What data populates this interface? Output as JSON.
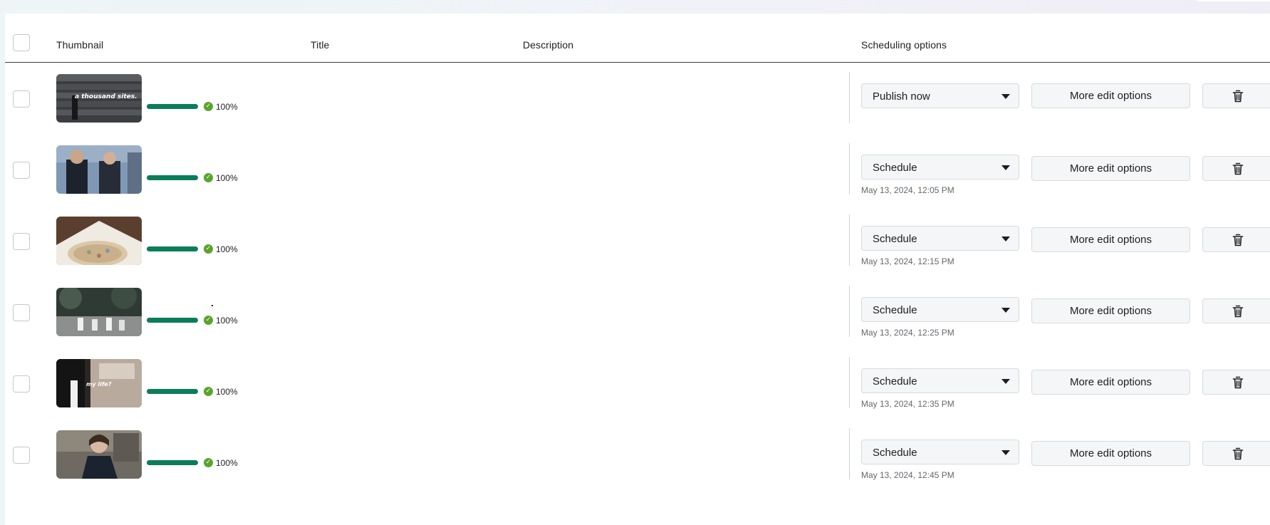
{
  "header": {
    "thumbnail": "Thumbnail",
    "title": "Title",
    "description": "Description",
    "scheduling": "Scheduling options"
  },
  "rows": [
    {
      "thumb_caption": "a thousand sites.",
      "progress_percent": 100,
      "progress_label": "100%",
      "schedule_option": "Publish now",
      "date": "",
      "edit_label": "More edit options"
    },
    {
      "thumb_caption": "",
      "progress_percent": 100,
      "progress_label": "100%",
      "schedule_option": "Schedule",
      "date": "May 13, 2024, 12:05 PM",
      "edit_label": "More edit options"
    },
    {
      "thumb_caption": "",
      "progress_percent": 100,
      "progress_label": "100%",
      "schedule_option": "Schedule",
      "date": "May 13, 2024, 12:15 PM",
      "edit_label": "More edit options"
    },
    {
      "thumb_caption": "",
      "progress_percent": 100,
      "progress_label": "100%",
      "schedule_option": "Schedule",
      "date": "May 13, 2024, 12:25 PM",
      "edit_label": "More edit options"
    },
    {
      "thumb_caption": "my life?",
      "progress_percent": 100,
      "progress_label": "100%",
      "schedule_option": "Schedule",
      "date": "May 13, 2024, 12:35 PM",
      "edit_label": "More edit options"
    },
    {
      "thumb_caption": "",
      "progress_percent": 100,
      "progress_label": "100%",
      "schedule_option": "Schedule",
      "date": "May 13, 2024, 12:45 PM",
      "edit_label": "More edit options"
    }
  ],
  "icons": {
    "status": "check-circle-icon",
    "dropdown": "chevron-down-icon",
    "delete": "trash-icon"
  },
  "colors": {
    "progress_fill": "#0b7d5a",
    "success_check": "#58a52b"
  }
}
